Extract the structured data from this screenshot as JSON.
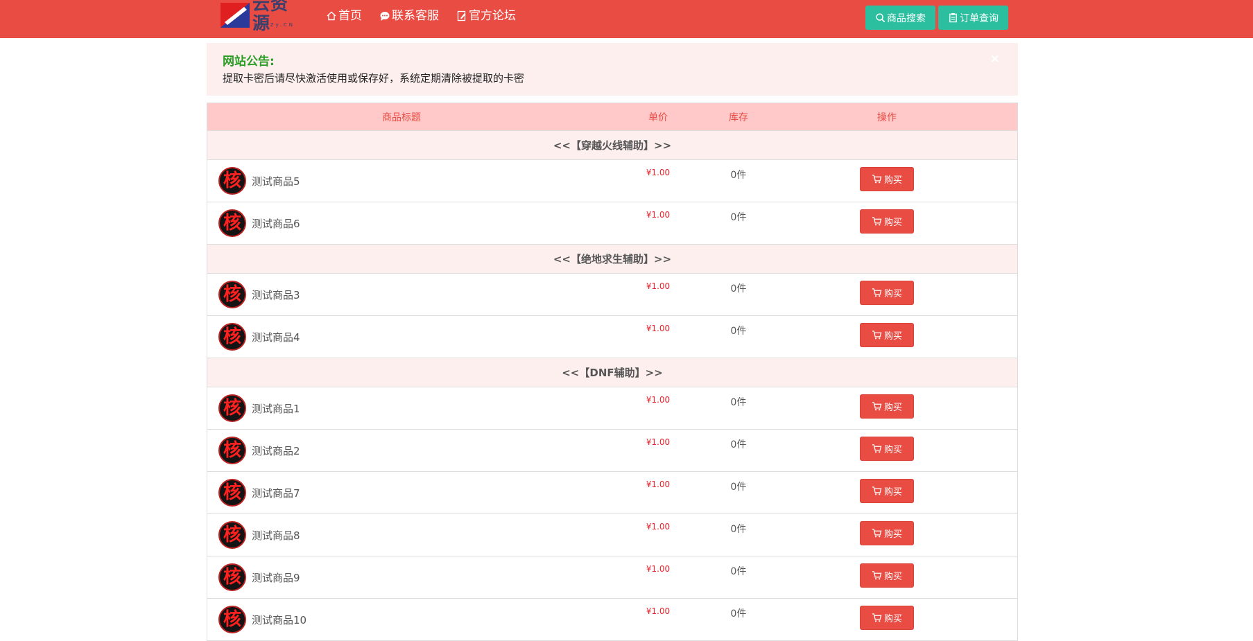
{
  "header": {
    "logo_text": "云资源",
    "logo_sub": "EMaZy.CN",
    "nav": [
      {
        "label": "首页",
        "icon": "home-icon"
      },
      {
        "label": "联系客服",
        "icon": "chat-icon"
      },
      {
        "label": "官方论坛",
        "icon": "forum-icon"
      }
    ],
    "search_btn": "商品搜索",
    "order_btn": "订单查询"
  },
  "notice": {
    "title": "网站公告:",
    "text": "提取卡密后请尽快激活使用或保存好，系统定期清除被提取的卡密",
    "close": "×"
  },
  "table": {
    "headers": {
      "title": "商品标题",
      "price": "单价",
      "stock": "库存",
      "op": "操作"
    },
    "buy_label": "购买",
    "avatar_char": "核",
    "groups": [
      {
        "category": "<<【穿越火线辅助】>>",
        "products": [
          {
            "name": "测试商品5",
            "price": "¥1.00",
            "stock": "0件"
          },
          {
            "name": "测试商品6",
            "price": "¥1.00",
            "stock": "0件"
          }
        ]
      },
      {
        "category": "<<【绝地求生辅助】>>",
        "products": [
          {
            "name": "测试商品3",
            "price": "¥1.00",
            "stock": "0件"
          },
          {
            "name": "测试商品4",
            "price": "¥1.00",
            "stock": "0件"
          }
        ]
      },
      {
        "category": "<<【DNF辅助】>>",
        "products": [
          {
            "name": "测试商品1",
            "price": "¥1.00",
            "stock": "0件"
          },
          {
            "name": "测试商品2",
            "price": "¥1.00",
            "stock": "0件"
          },
          {
            "name": "测试商品7",
            "price": "¥1.00",
            "stock": "0件"
          },
          {
            "name": "测试商品8",
            "price": "¥1.00",
            "stock": "0件"
          },
          {
            "name": "测试商品9",
            "price": "¥1.00",
            "stock": "0件"
          },
          {
            "name": "测试商品10",
            "price": "¥1.00",
            "stock": "0件"
          }
        ]
      }
    ]
  },
  "colors": {
    "header_bg": "#e84c43",
    "accent_green": "#2bbf9f",
    "notice_bg": "#fdefee",
    "price_red": "#e8202a"
  }
}
